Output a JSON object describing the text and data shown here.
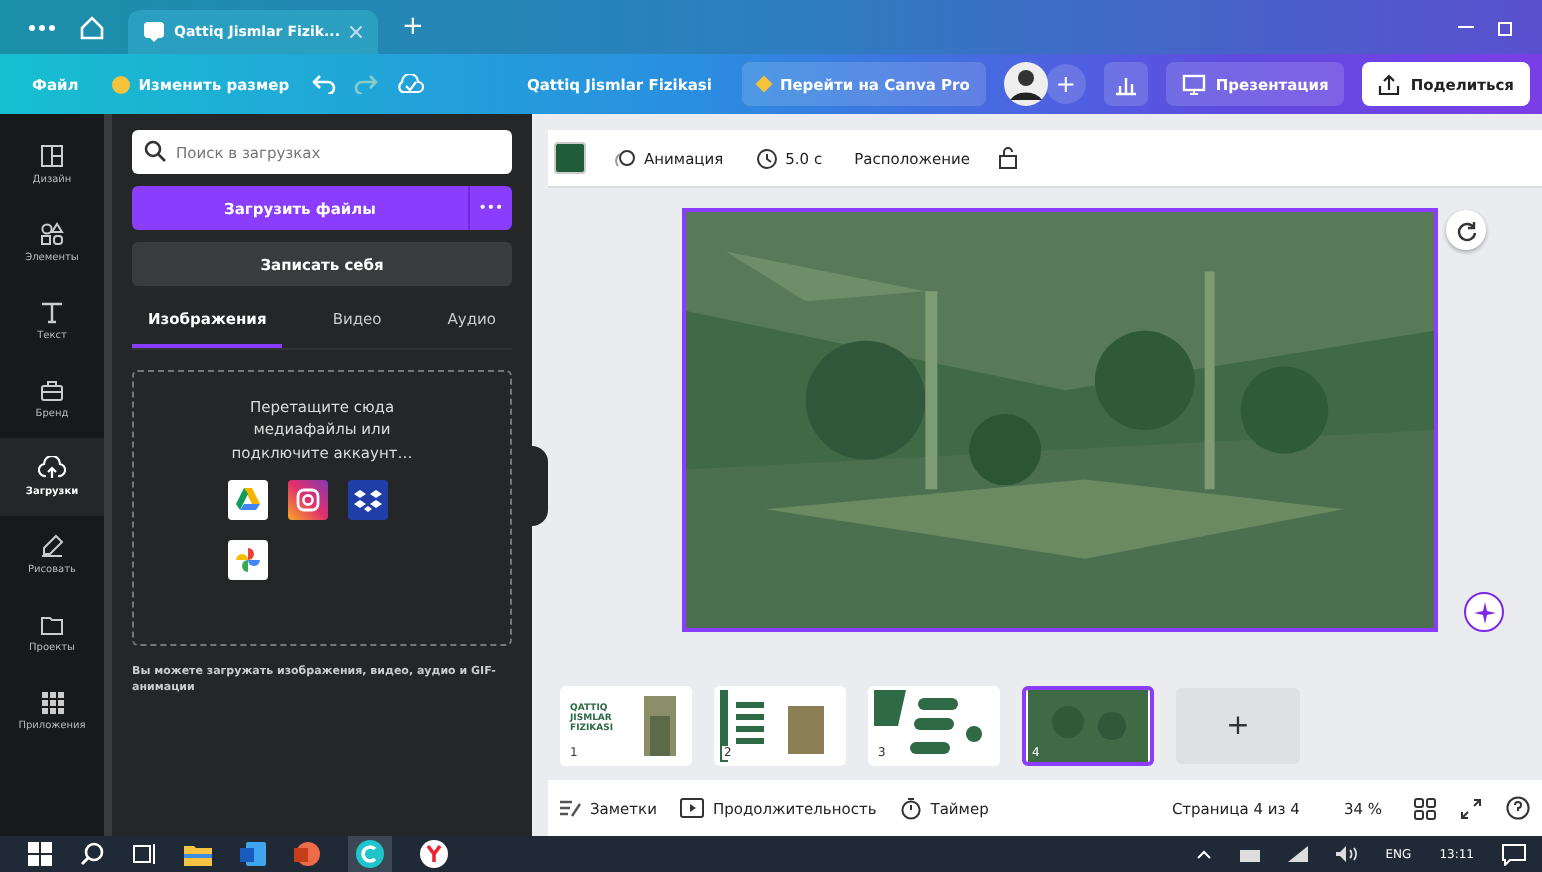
{
  "browser": {
    "tab_title": "Qattiq Jismlar Fizik...",
    "new_tab": "+"
  },
  "header": {
    "file_menu": "Файл",
    "resize": "Изменить размер",
    "title": "Qattiq Jismlar Fizikasi",
    "pro": "Перейти на Canva Pro",
    "add": "+",
    "present": "Презентация",
    "share": "Поделиться"
  },
  "rail": [
    {
      "kind": "design",
      "label": "Дизайн",
      "selected": false
    },
    {
      "kind": "elements",
      "label": "Элементы",
      "selected": false
    },
    {
      "kind": "text",
      "label": "Текст",
      "selected": false
    },
    {
      "kind": "brand",
      "label": "Бренд",
      "selected": false
    },
    {
      "kind": "uploads",
      "label": "Загрузки",
      "selected": true
    },
    {
      "kind": "draw",
      "label": "Рисовать",
      "selected": false
    },
    {
      "kind": "projects",
      "label": "Проекты",
      "selected": false
    },
    {
      "kind": "apps",
      "label": "Приложения",
      "selected": false
    }
  ],
  "panel": {
    "search": {
      "placeholder": "Поиск в загрузках"
    },
    "upload": "Загрузить файлы",
    "more": "•••",
    "record": "Записать себя",
    "tabs": [
      {
        "label": "Изображения",
        "selected": true
      },
      {
        "label": "Видео",
        "selected": false
      },
      {
        "label": "Аудио",
        "selected": false
      }
    ],
    "drop_text": "Перетащите сюда медиафайлы или подключите аккаунт…",
    "hint": "Вы можете загружать изображения, видео, аудио и GIF-анимации"
  },
  "toolbar": {
    "color": "#1f5c3a",
    "animation": "Анимация",
    "duration": "5.0 с",
    "position": "Расположение"
  },
  "pages": [
    {
      "number": "1",
      "kind": "title",
      "title": "QATTIQ JISMLAR FIZIKASI",
      "selected": false
    },
    {
      "number": "2",
      "kind": "list",
      "selected": false
    },
    {
      "number": "3",
      "kind": "diagram",
      "selected": false
    },
    {
      "number": "4",
      "selected": true
    }
  ],
  "add_page": "+",
  "bottom": {
    "notes": "Заметки",
    "duration": "Продолжительность",
    "timer": "Таймер",
    "page": "Страница 4 из 4",
    "zoom": "34 %"
  },
  "taskbar": {
    "language": "ENG",
    "time": "13:11"
  }
}
